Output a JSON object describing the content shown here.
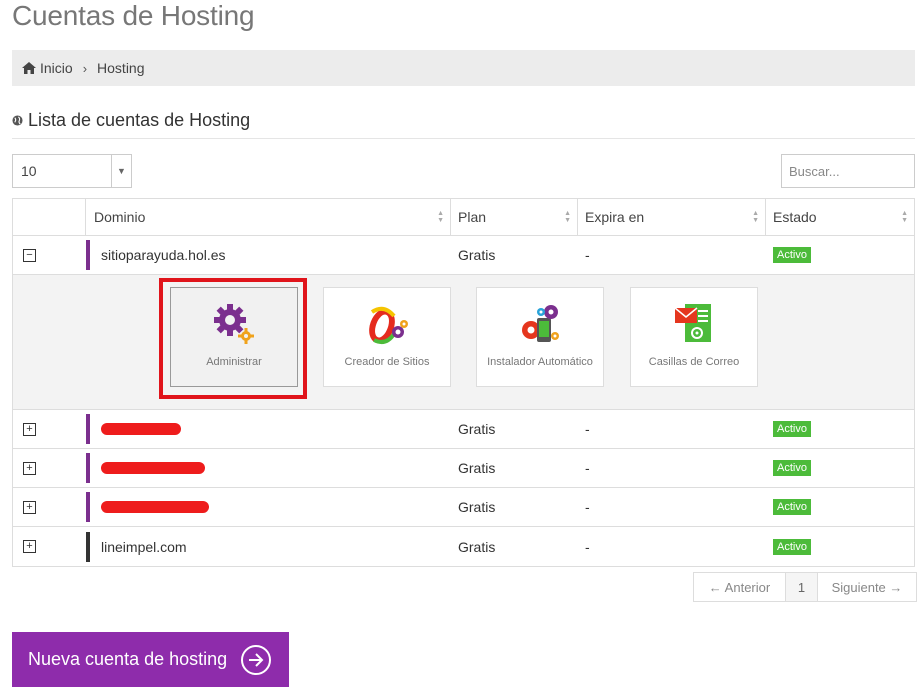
{
  "page": {
    "title": "Cuentas de Hosting"
  },
  "breadcrumb": {
    "home": "Inicio",
    "current": "Hosting"
  },
  "section": {
    "title": "Lista de cuentas de Hosting"
  },
  "controls": {
    "page_length": "10",
    "search_placeholder": "Buscar..."
  },
  "table": {
    "headers": [
      "Dominio",
      "Plan",
      "Expira en",
      "Estado"
    ],
    "rows": [
      {
        "domain": "sitioparayuda.hol.es",
        "plan": "Gratis",
        "expires": "-",
        "status": "Activo",
        "toggle": "−",
        "expanded": true
      },
      {
        "domain": "",
        "plan": "Gratis",
        "expires": "-",
        "status": "Activo",
        "toggle": "+",
        "redacted": true
      },
      {
        "domain": "",
        "plan": "Gratis",
        "expires": "-",
        "status": "Activo",
        "toggle": "+",
        "redacted": true
      },
      {
        "domain": "",
        "plan": "Gratis",
        "expires": "-",
        "status": "Activo",
        "toggle": "+",
        "redacted": true
      },
      {
        "domain": "lineimpel.com",
        "plan": "Gratis",
        "expires": "-",
        "status": "Activo",
        "toggle": "+"
      }
    ],
    "tools": [
      {
        "label": "Administrar",
        "icon": "gears-icon"
      },
      {
        "label": "Creador de Sitios",
        "icon": "site-builder-icon"
      },
      {
        "label": "Instalador Automático",
        "icon": "auto-installer-icon"
      },
      {
        "label": "Casillas de Correo",
        "icon": "mail-icon"
      }
    ]
  },
  "pagination": {
    "prev": "← Anterior",
    "page": "1",
    "next": "Siguiente →"
  },
  "actions": {
    "new_account": "Nueva cuenta de hosting"
  },
  "colors": {
    "brand": "#8e2cab",
    "accent_bar": "#7b2f8e",
    "status_active": "#4cbb3a",
    "highlight": "#e0141b",
    "redaction": "#ee1c1c"
  }
}
